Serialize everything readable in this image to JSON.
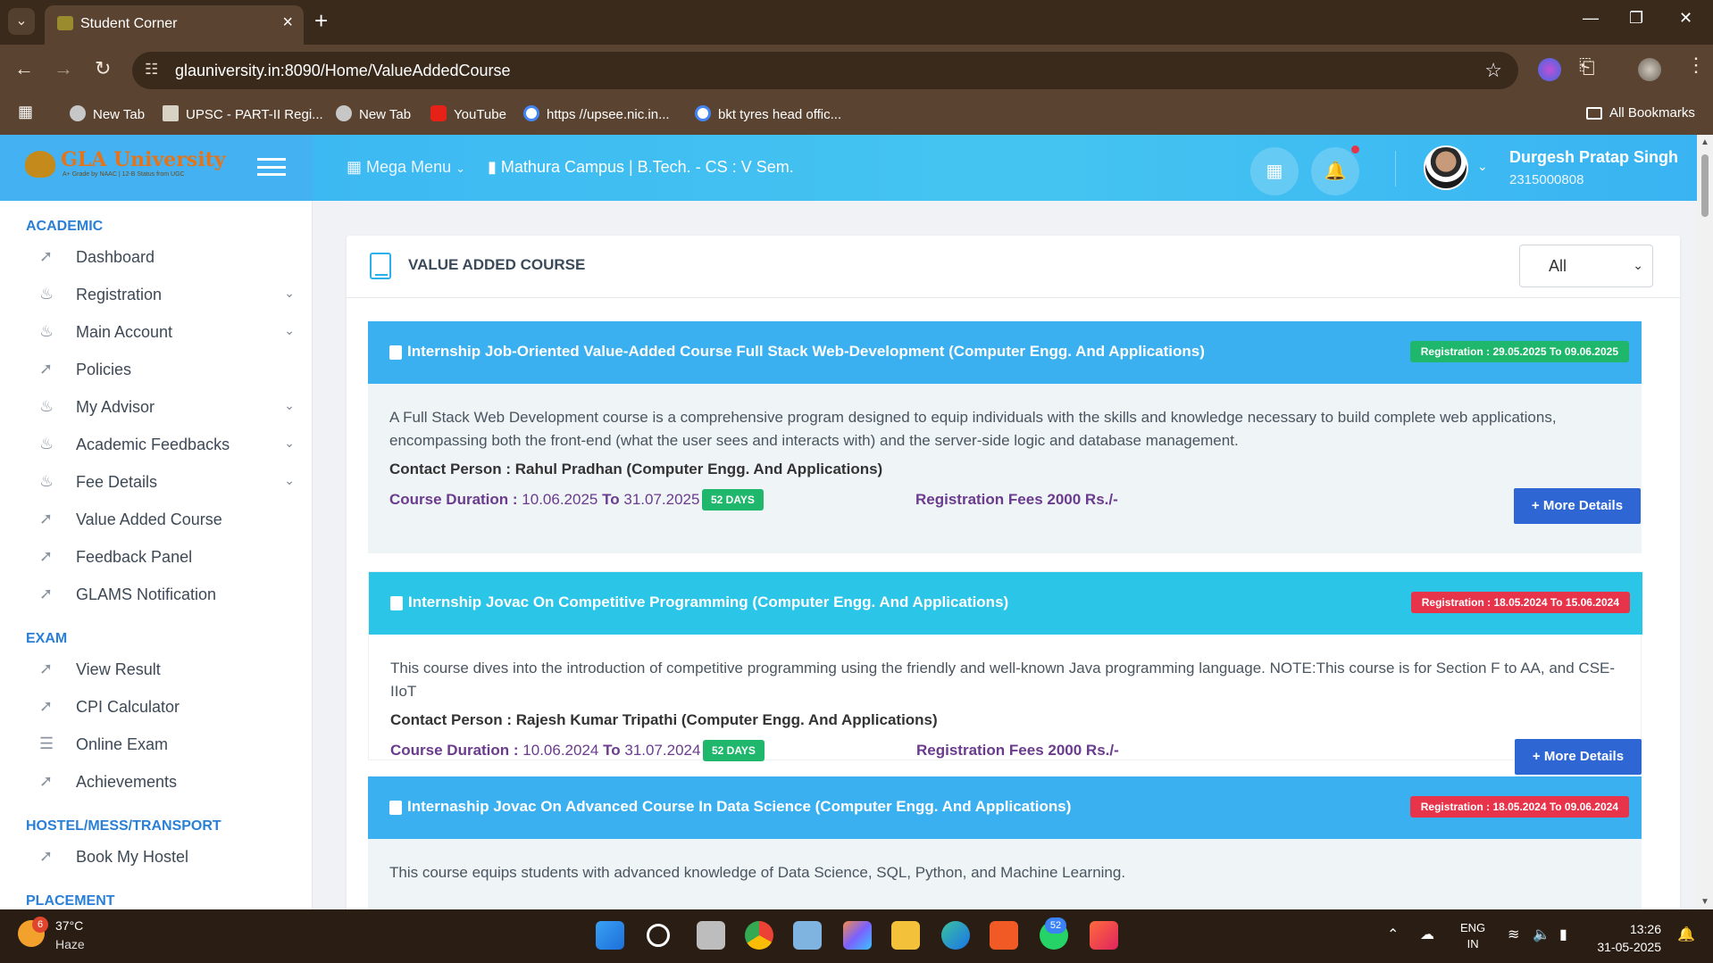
{
  "browser": {
    "tab_title": "Student Corner",
    "url": "glauniversity.in:8090/Home/ValueAddedCourse",
    "bookmarks": [
      "New Tab",
      "UPSC - PART-II Regi...",
      "New Tab",
      "YouTube",
      "https //upsee.nic.in...",
      "bkt tyres head offic..."
    ],
    "all_bookmarks": "All Bookmarks"
  },
  "header": {
    "logo_text": "GLA University",
    "logo_sub": "A+ Grade by NAAC | 12-B Status from UGC",
    "mega_menu": "Mega Menu",
    "campus": "Mathura Campus | B.Tech. - CS : V Sem.",
    "user_name": "Durgesh Pratap Singh",
    "user_id": "2315000808"
  },
  "sidebar": {
    "sections": [
      {
        "title": "ACADEMIC",
        "items": [
          {
            "label": "Dashboard",
            "icon": "chart-line-icon",
            "caret": false
          },
          {
            "label": "Registration",
            "icon": "rocket-icon",
            "caret": true
          },
          {
            "label": "Main Account",
            "icon": "rocket-icon",
            "caret": true
          },
          {
            "label": "Policies",
            "icon": "chart-line-icon",
            "caret": false
          },
          {
            "label": "My Advisor",
            "icon": "rocket-icon",
            "caret": true
          },
          {
            "label": "Academic Feedbacks",
            "icon": "rocket-icon",
            "caret": true
          },
          {
            "label": "Fee Details",
            "icon": "rocket-icon",
            "caret": true
          },
          {
            "label": "Value Added Course",
            "icon": "chart-line-icon",
            "caret": false
          },
          {
            "label": "Feedback Panel",
            "icon": "chart-line-icon",
            "caret": false
          },
          {
            "label": "GLAMS Notification",
            "icon": "chart-line-icon",
            "caret": false
          }
        ]
      },
      {
        "title": "EXAM",
        "items": [
          {
            "label": "View Result",
            "icon": "chart-line-icon",
            "caret": false
          },
          {
            "label": "CPI Calculator",
            "icon": "chart-line-icon",
            "caret": false
          },
          {
            "label": "Online Exam",
            "icon": "signpost-icon",
            "caret": false
          },
          {
            "label": "Achievements",
            "icon": "chart-line-icon",
            "caret": false
          }
        ]
      },
      {
        "title": "HOSTEL/MESS/TRANSPORT",
        "items": [
          {
            "label": "Book My Hostel",
            "icon": "chart-line-icon",
            "caret": false
          }
        ]
      },
      {
        "title": "PLACEMENT",
        "items": []
      }
    ]
  },
  "content": {
    "title": "VALUE ADDED COURSE",
    "filter_value": "All",
    "courses": [
      {
        "title": "Internship Job-Oriented Value-Added Course Full Stack Web-Development (Computer Engg. And Applications)",
        "registration": "Registration : 29.05.2025 To 09.06.2025",
        "registration_color": "#1fb76b",
        "header_color": "#3ab0f0",
        "description": "A Full Stack Web Development course is a comprehensive program designed to equip individuals with the skills and knowledge necessary to build complete web applications, encompassing both the front-end (what the user sees and interacts with) and the server-side logic and database management.",
        "contact": "Contact Person : Rahul Pradhan (Computer Engg. And Applications)",
        "duration_label": "Course Duration :",
        "from": "10.06.2025",
        "to_word": "To",
        "to": "31.07.2025",
        "days": "52 DAYS",
        "fees": "Registration Fees 2000 Rs./-",
        "button": "More Details"
      },
      {
        "title": "Internship Jovac On Competitive Programming (Computer Engg. And Applications)",
        "registration": "Registration : 18.05.2024 To 15.06.2024",
        "registration_color": "#e8344a",
        "header_color": "#2bc5e8",
        "description": "This course dives into the introduction of competitive programming using the friendly and well-known Java programming language. NOTE:This course is for Section F to AA, and CSE-IIoT",
        "contact": "Contact Person : Rajesh Kumar Tripathi (Computer Engg. And Applications)",
        "duration_label": "Course Duration :",
        "from": "10.06.2024",
        "to_word": "To",
        "to": "31.07.2024",
        "days": "52 DAYS",
        "fees": "Registration Fees 2000 Rs./-",
        "button": "More Details"
      },
      {
        "title": "Internaship Jovac On Advanced Course In Data Science (Computer Engg. And Applications)",
        "registration": "Registration : 18.05.2024 To 09.06.2024",
        "registration_color": "#e8344a",
        "header_color": "#3ab0f0",
        "description": "This course equips students with advanced knowledge of Data Science, SQL, Python, and Machine Learning."
      }
    ]
  },
  "taskbar": {
    "temp": "37°C",
    "condition": "Haze",
    "weather_badge": "6",
    "whatsapp_badge": "52",
    "lang_line1": "ENG",
    "lang_line2": "IN",
    "time": "13:26",
    "date": "31-05-2025"
  }
}
